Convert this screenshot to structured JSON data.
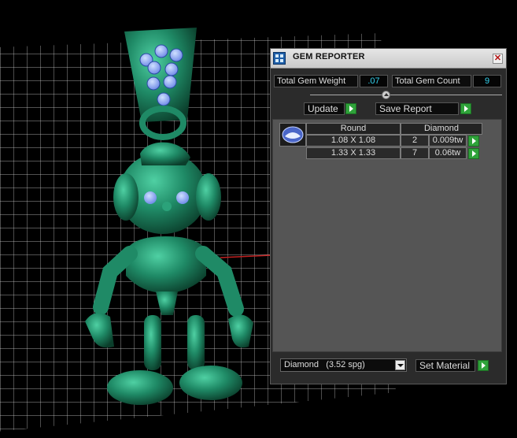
{
  "panel": {
    "title": "GEM REPORTER",
    "close_symbol": "✕",
    "total_gem_weight_label": "Total Gem Weight",
    "total_gem_weight_value": ".07",
    "total_gem_count_label": "Total Gem Count",
    "total_gem_count_value": "9",
    "update_label": "Update",
    "save_report_label": "Save Report",
    "table": {
      "headers": [
        "Round",
        "Diamond"
      ],
      "rows": [
        {
          "size": "1.08 X 1.08",
          "count": "2",
          "weight": "0.009tw"
        },
        {
          "size": "1.33 X 1.33",
          "count": "7",
          "weight": "0.06tw"
        }
      ]
    },
    "material_select": {
      "value": "Diamond",
      "spg": "(3.52 spg)"
    },
    "set_material_label": "Set Material"
  },
  "icons": {
    "app": "gem-reporter-app-icon",
    "close": "close-icon",
    "go": "green-play-arrow-icon",
    "dropdown": "chevron-down-icon",
    "gem": "round-gem-icon"
  },
  "colors": {
    "model_green": "#1f8a66",
    "value_cyan": "#33d3f0",
    "go_green": "#2fa33a",
    "gem_blue": "#8fb3ff"
  }
}
